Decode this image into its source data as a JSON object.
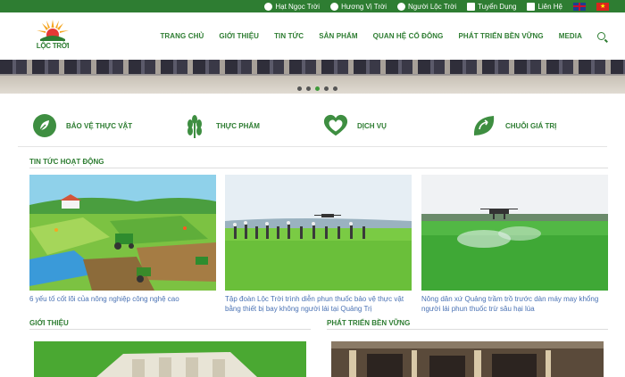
{
  "topbar": {
    "links": [
      {
        "icon": "globe-icon",
        "label": "Hạt Ngọc Trời"
      },
      {
        "icon": "globe-icon",
        "label": "Hương Vị Trời"
      },
      {
        "icon": "globe-icon",
        "label": "Người Lộc Trời"
      },
      {
        "icon": "people-icon",
        "label": "Tuyển Dụng"
      },
      {
        "icon": "mail-icon",
        "label": "Liên Hệ"
      }
    ],
    "languages": [
      "en-flag-icon",
      "vn-flag-icon"
    ]
  },
  "logo": {
    "text": "LỘC TRỜI"
  },
  "nav": {
    "items": [
      "TRANG CHỦ",
      "GIỚI THIỆU",
      "TIN TỨC",
      "SẢN PHẨM",
      "QUAN HỆ CỔ ĐÔNG",
      "PHÁT TRIỂN BỀN VỮNG",
      "MEDIA"
    ]
  },
  "slider": {
    "dot_count": 5,
    "active_index": 2
  },
  "services": [
    {
      "icon": "plant-protection-icon",
      "label": "BẢO VỆ THỰC VẬT"
    },
    {
      "icon": "rice-grain-icon",
      "label": "THỰC PHẨM"
    },
    {
      "icon": "heart-hands-icon",
      "label": "DỊCH VỤ"
    },
    {
      "icon": "leaf-cycle-icon",
      "label": "CHUỖI GIÁ TRỊ"
    }
  ],
  "news": {
    "title": "TIN TỨC HOẠT ĐỘNG",
    "items": [
      {
        "caption": "6 yếu tố cốt lõi của nông nghiệp công nghệ cao"
      },
      {
        "caption": "Tập đoàn Lộc Trời trình diễn phun thuốc bảo vệ thực vật bằng thiết bị bay không người lái tại Quảng Trị"
      },
      {
        "caption": "Nông dân xứ Quảng trầm trồ trước dàn máy may khổng người lái phun thuốc trừ sâu hại lúa"
      }
    ]
  },
  "sections": {
    "about_title": "GIỚI THIỆU",
    "sustain_title": "PHÁT TRIỂN BỀN VỮNG"
  },
  "colors": {
    "brand": "#2e7d32",
    "link": "#4a72b4"
  }
}
